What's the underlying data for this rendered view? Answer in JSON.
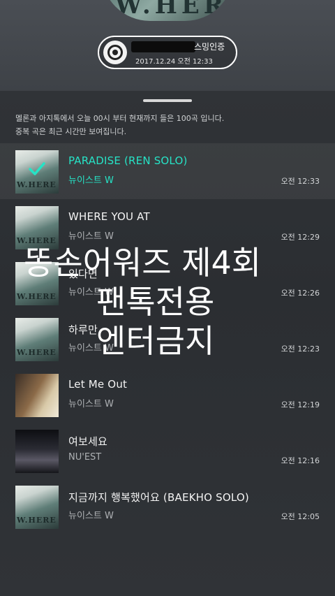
{
  "header": {
    "album_art_text": "W.HERE",
    "cert_label": "스밍인증",
    "cert_datetime": "2017.12.24  오전 12:33"
  },
  "notice": {
    "line1": "멜론과 아지톡에서 오늘 00시 부터 현재까지 들은 100곡 입니다.",
    "line2": "중복 곡은 최근 시간만 보여집니다."
  },
  "tracks": [
    {
      "title": "PARADISE (REN SOLO)",
      "artist": "뉴이스트 W",
      "time": "오전 12:33",
      "selected": true
    },
    {
      "title": "WHERE YOU AT",
      "artist": "뉴이스트 W",
      "time": "오전 12:29",
      "selected": false
    },
    {
      "title": "있다면",
      "artist": "뉴이스트 W",
      "time": "오전 12:26",
      "selected": false
    },
    {
      "title": "하루만",
      "artist": "뉴이스트 W",
      "time": "오전 12:23",
      "selected": false
    },
    {
      "title": "Let Me Out",
      "artist": "뉴이스트 W",
      "time": "오전 12:19",
      "selected": false
    },
    {
      "title": "여보세요",
      "artist": "NU'EST",
      "time": "오전 12:16",
      "selected": false
    },
    {
      "title": "지금까지 행복했어요 (BAEKHO SOLO)",
      "artist": "뉴이스트 W",
      "time": "오전 12:05",
      "selected": false
    }
  ],
  "watermark": {
    "line1": "똥손어워즈 제4회",
    "line2": "팬톡전용",
    "line3": "엔터금지"
  },
  "colors": {
    "accent": "#26e3c6",
    "background": "#2a2d31"
  }
}
